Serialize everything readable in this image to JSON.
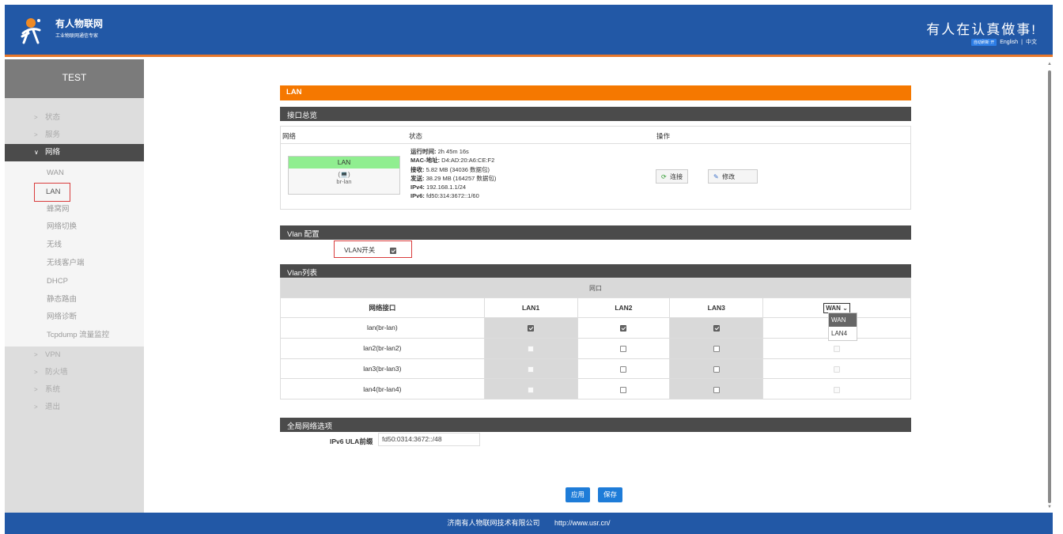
{
  "header": {
    "brand": "有人物联网",
    "brand_sub": "工业物联网通信专家",
    "slogan": "有人在认真做事!",
    "lang_badge": "自动刷新 开",
    "lang_en": "English",
    "lang_sep": "|",
    "lang_zh": "中文"
  },
  "sidebar": {
    "title": "TEST",
    "items_top": [
      {
        "label": "状态"
      },
      {
        "label": "服务"
      }
    ],
    "active_group": "网络",
    "sub_items": [
      "WAN",
      "LAN",
      "蜂窝网",
      "网络切换",
      "无线",
      "无线客户端",
      "DHCP",
      "静态路由",
      "网络诊断",
      "Tcpdump 流量监控"
    ],
    "items_bottom": [
      {
        "label": "VPN"
      },
      {
        "label": "防火墙"
      },
      {
        "label": "系统"
      },
      {
        "label": "退出"
      }
    ]
  },
  "main": {
    "page_title": "LAN",
    "overview": {
      "section_title": "接口总览",
      "col_network": "网络",
      "col_status": "状态",
      "col_action": "操作",
      "card_name": "LAN",
      "card_icon_text": "(💻)",
      "card_device": "br-lan",
      "status": {
        "uptime_label": "运行时间:",
        "uptime": "2h 45m 16s",
        "mac_label": "MAC-地址:",
        "mac": "D4:AD:20:A6:CE:F2",
        "rx_label": "接收:",
        "rx": "5.82 MB (34036 数据包)",
        "tx_label": "发送:",
        "tx": "38.29 MB (164257 数据包)",
        "ipv4_label": "IPv4:",
        "ipv4": "192.168.1.1/24",
        "ipv6_label": "IPv6:",
        "ipv6": "fd50:314:3672::1/60"
      },
      "connect_label": "连接",
      "edit_label": "修改"
    },
    "vlan_config": {
      "section_title": "Vlan 配置",
      "switch_label": "VLAN开关",
      "switch_checked": true
    },
    "vlan_list": {
      "section_title": "Vlan列表",
      "port_header": "网口",
      "iface_header": "网络接口",
      "columns": [
        "LAN1",
        "LAN2",
        "LAN3"
      ],
      "wan_select_value": "WAN",
      "wan_options": [
        "WAN",
        "LAN4"
      ],
      "rows": [
        {
          "name": "lan(br-lan)"
        },
        {
          "name": "lan2(br-lan2)"
        },
        {
          "name": "lan3(br-lan3)"
        },
        {
          "name": "lan4(br-lan4)"
        }
      ]
    },
    "global": {
      "section_title": "全局网络选项",
      "ula_label": "IPv6 ULA前缀",
      "ula_value": "fd50:0314:3672::/48"
    },
    "apply_label": "应用",
    "save_label": "保存"
  },
  "footer": {
    "company": "济南有人物联网技术有限公司",
    "url": "http://www.usr.cn/"
  }
}
